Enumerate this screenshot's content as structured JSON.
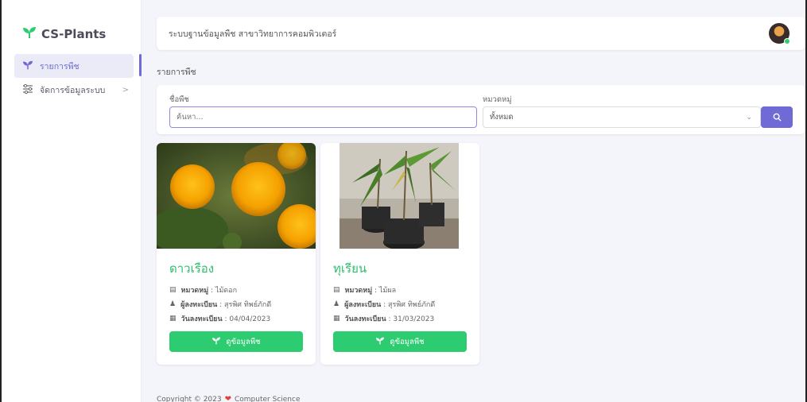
{
  "app": {
    "brand": "CS-Plants"
  },
  "sidebar": {
    "items": [
      {
        "label": "รายการพืช",
        "icon": "sprout-icon",
        "active": true
      },
      {
        "label": "จัดการข้อมูลระบบ",
        "icon": "sliders-icon",
        "active": false,
        "chevron": ">"
      }
    ]
  },
  "topbar": {
    "title": "ระบบฐานข้อมูลพืช สาขาวิทยาการคอมพิวเตอร์"
  },
  "page": {
    "heading": "รายการพืช"
  },
  "filter": {
    "name_label": "ชื่อพืช",
    "name_placeholder": "ค้นหา...",
    "category_label": "หมวดหมู่",
    "category_value": "ทั้งหมด"
  },
  "cards": [
    {
      "name": "ดาวเรือง",
      "category_label": "หมวดหมู่",
      "category": "ไม้ดอก",
      "registrar_label": "ผู้ลงทะเบียน",
      "registrar": "สุรพิศ ทิพย์ภักดี",
      "date_label": "วันลงทะเบียน",
      "date": "04/04/2023",
      "button": "ดูข้อมูลพืช"
    },
    {
      "name": "ทุเรียน",
      "category_label": "หมวดหมู่",
      "category": "ไม้ผล",
      "registrar_label": "ผู้ลงทะเบียน",
      "registrar": "สุรพิศ ทิพย์ภักดี",
      "date_label": "วันลงทะเบียน",
      "date": "31/03/2023",
      "button": "ดูข้อมูลพืช"
    }
  ],
  "footer": {
    "text": "Copyright © 2023",
    "org": "Computer Science"
  },
  "colors": {
    "accent": "#6f6ad6",
    "green": "#2ecc71",
    "title_green": "#2dbd6e"
  }
}
